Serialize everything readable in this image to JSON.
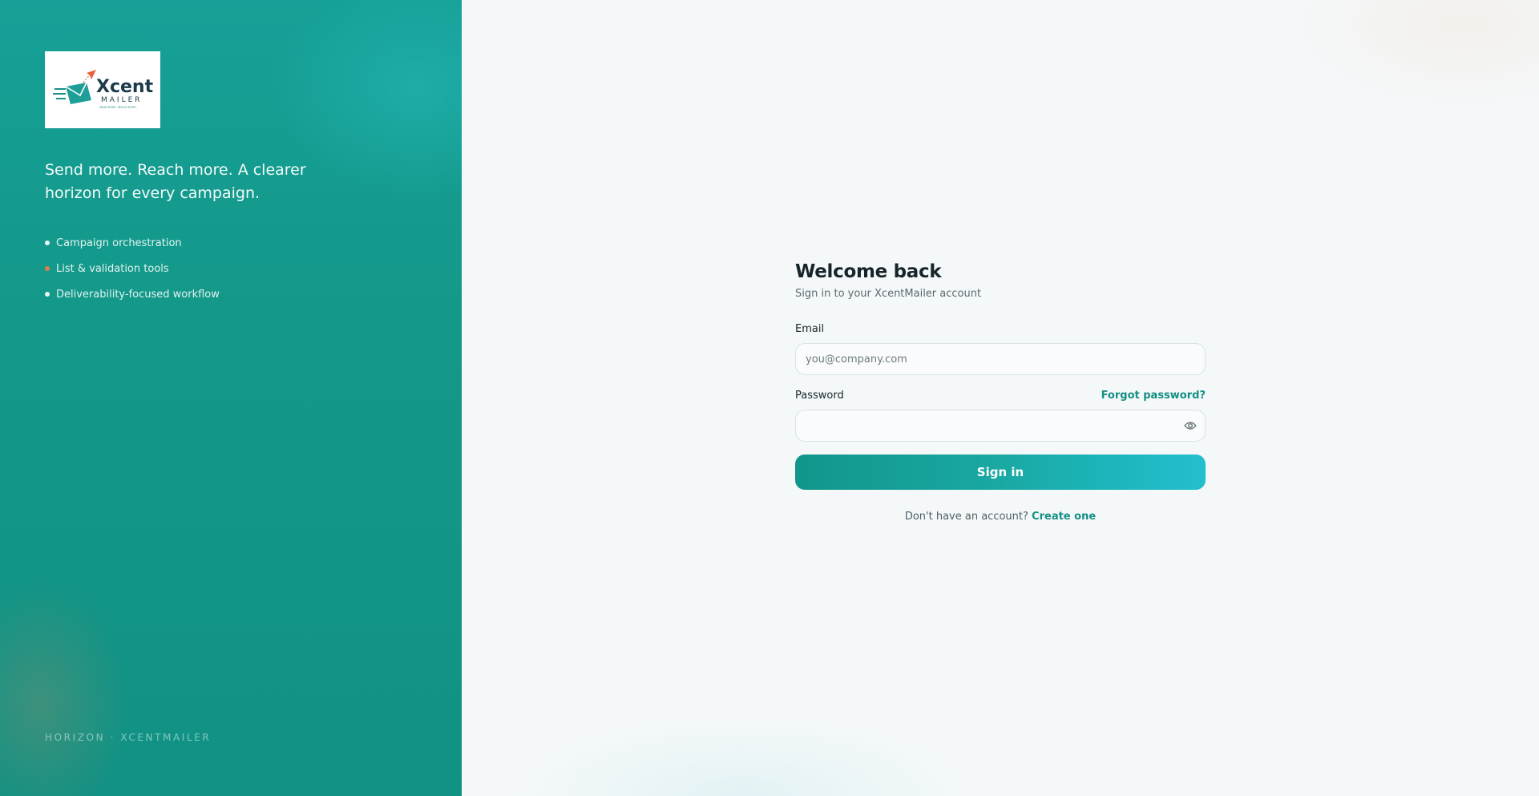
{
  "brand": {
    "logo_word": "Xcent",
    "logo_sub": "MAILER",
    "logo_tagline": "SEND MORE. REACH MORE."
  },
  "left": {
    "tagline": "Send more. Reach more. A clearer horizon for every campaign.",
    "features": [
      "Campaign orchestration",
      "List & validation tools",
      "Deliverability-focused workflow"
    ],
    "footer": "HORIZON · XCENTMAILER"
  },
  "form": {
    "title": "Welcome back",
    "subtitle": "Sign in to your XcentMailer account",
    "email_label": "Email",
    "email_placeholder": "you@company.com",
    "email_value": "",
    "password_label": "Password",
    "forgot_label": "Forgot password?",
    "password_value": "",
    "submit_label": "Sign in",
    "signup_prompt": "Don't have an account?",
    "signup_link": "Create one"
  },
  "colors": {
    "brand_teal": "#16a097",
    "accent_orange": "#e07b4a",
    "link": "#138f84"
  },
  "icons": {
    "password_toggle": "eye-icon",
    "feature_bullet": "dot-icon"
  }
}
